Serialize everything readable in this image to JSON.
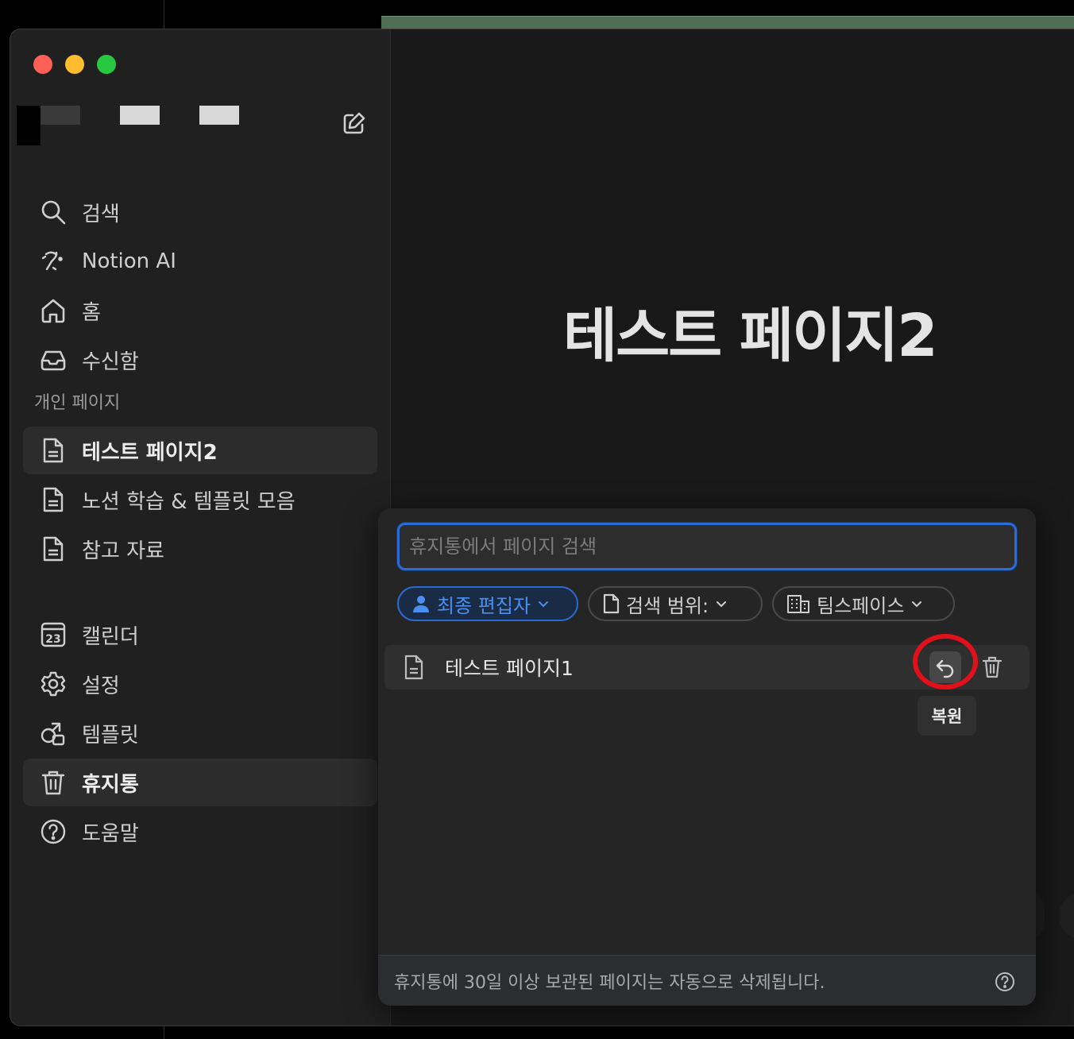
{
  "app": {
    "name": "Notion"
  },
  "sidebar": {
    "new_page_icon": "compose-icon",
    "top_items": [
      {
        "label": "검색",
        "icon": "search-icon"
      },
      {
        "label": "Notion AI",
        "icon": "notion-ai-icon"
      },
      {
        "label": "홈",
        "icon": "home-icon"
      },
      {
        "label": "수신함",
        "icon": "inbox-icon"
      }
    ],
    "section_label": "개인 페이지",
    "pages": [
      {
        "label": "테스트 페이지2",
        "icon": "page-icon",
        "active": true
      },
      {
        "label": "노션 학습 & 템플릿 모음",
        "icon": "page-icon"
      },
      {
        "label": "참고 자료",
        "icon": "page-icon"
      }
    ],
    "bottom_items": [
      {
        "label": "캘린더",
        "icon": "calendar-icon",
        "badge": "23"
      },
      {
        "label": "설정",
        "icon": "gear-icon"
      },
      {
        "label": "템플릿",
        "icon": "template-icon"
      },
      {
        "label": "휴지통",
        "icon": "trash-icon",
        "active": true
      },
      {
        "label": "도움말",
        "icon": "help-icon"
      }
    ]
  },
  "page": {
    "title": "테스트 페이지2"
  },
  "trash": {
    "search_placeholder": "휴지통에서 페이지 검색",
    "search_value": "",
    "filters": [
      {
        "label": "최종 편집자",
        "icon": "person-icon",
        "primary": true
      },
      {
        "label": "검색 범위:",
        "icon": "page-icon"
      },
      {
        "label": "팀스페이스",
        "icon": "building-icon"
      }
    ],
    "items": [
      {
        "name": "테스트 페이지1",
        "icon": "page-icon"
      }
    ],
    "restore_tooltip": "복원",
    "highlight_color": "#e1101a",
    "footer_note": "휴지통에 30일 이상 보관된 페이지는 자동으로 삭제됩니다."
  },
  "colors": {
    "accent": "#2a6bd6",
    "accent_text": "#4a8ff0",
    "sidebar_bg": "#202020",
    "panel_bg": "#252525"
  }
}
